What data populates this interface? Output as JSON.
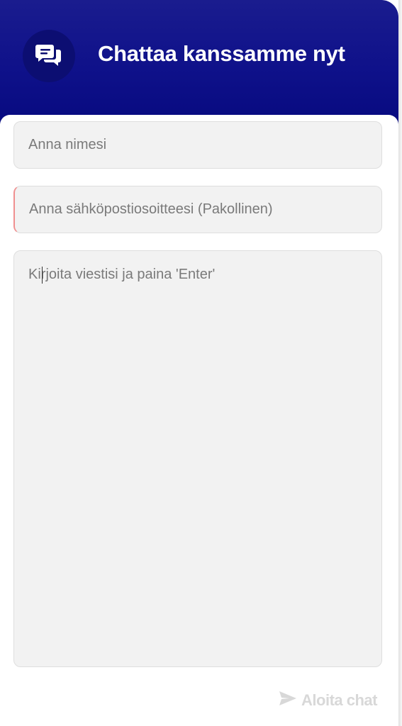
{
  "header": {
    "title": "Chattaa kanssamme nyt",
    "icon": "chat-bubbles-icon",
    "background_color": "#0f118a",
    "icon_circle_color": "#0c0e72"
  },
  "form": {
    "name_placeholder": "Anna nimesi",
    "email_placeholder": "Anna sähköpostiosoitteesi (Pakollinen)",
    "message_placeholder": "Kirjoita viestisi ja paina 'Enter'",
    "required_indicator_color": "#f08f8f"
  },
  "footer": {
    "start_label": "Aloita chat",
    "start_icon": "send-icon",
    "disabled_color": "#d8d8d8"
  }
}
